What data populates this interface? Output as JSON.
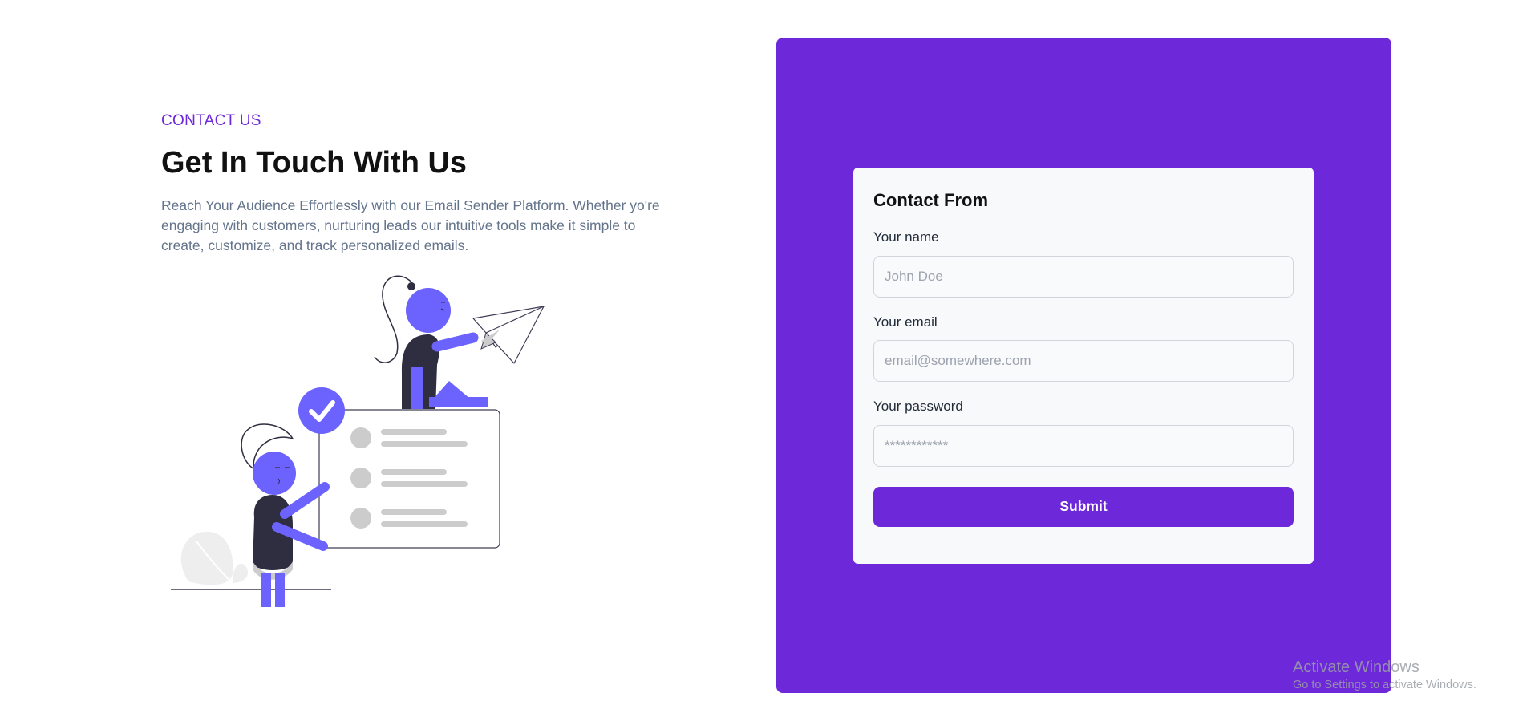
{
  "intro": {
    "eyebrow": "CONTACT US",
    "headline": "Get In Touch With Us",
    "description": "Reach Your Audience Effortlessly with our Email Sender Platform. Whether yo're engaging with customers, nurturing leads our intuitive tools make it simple to create, customize, and track personalized emails."
  },
  "form": {
    "title": "Contact From",
    "name_label": "Your name",
    "name_placeholder": "John Doe",
    "email_label": "Your email",
    "email_placeholder": "email@somewhere.com",
    "password_label": "Your password",
    "password_placeholder": "************",
    "submit_label": "Submit"
  },
  "watermark": {
    "title": "Activate Windows",
    "subtitle": "Go to Settings to activate Windows."
  },
  "colors": {
    "accent": "#6d28d9",
    "illustration_primary": "#6c63ff",
    "dark": "#2f2e41"
  },
  "illustration": {
    "icons": [
      "paper-plane-icon",
      "check-circle-icon"
    ]
  }
}
